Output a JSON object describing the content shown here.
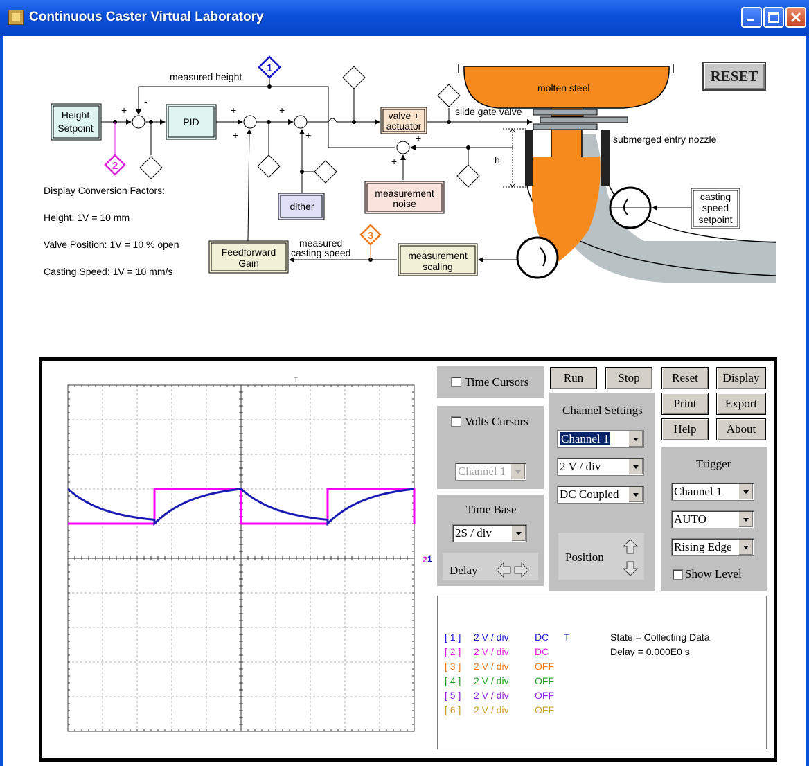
{
  "window": {
    "title": "Continuous Caster Virtual Laboratory"
  },
  "diagram": {
    "labels": {
      "measured_height": "measured height",
      "height_setpoint_1": "Height",
      "height_setpoint_2": "Setpoint",
      "pid": "PID",
      "valve_1": "valve +",
      "valve_2": "actuator",
      "slide_gate_valve": "slide gate valve",
      "molten_steel": "molten steel",
      "sen": "submerged entry nozzle",
      "h": "h",
      "dither": "dither",
      "noise_1": "measurement",
      "noise_2": "noise",
      "casting_speed_setpoint_1": "casting",
      "casting_speed_setpoint_2": "speed",
      "casting_speed_setpoint_3": "setpoint",
      "feedforward_1": "Feedforward",
      "feedforward_2": "Gain",
      "measured_casting_speed_1": "measured",
      "measured_casting_speed_2": "casting speed",
      "scaling_1": "measurement",
      "scaling_2": "scaling",
      "plus": "+",
      "minus": "-",
      "marker_1": "1",
      "marker_2": "2",
      "marker_3": "3"
    },
    "conversion": {
      "heading": "Display Conversion Factors:",
      "height": "Height:  1V = 10 mm",
      "valve": "Valve Position:  1V = 10 % open",
      "speed": "Casting Speed:  1V = 10 mm/s"
    },
    "reset_label": "RESET",
    "colors": {
      "marker_1": "#1515c8",
      "marker_2": "#e020e0",
      "marker_3": "#f07818",
      "steel": "#f78a1c",
      "nozzle": "#b8c2c4"
    }
  },
  "scope": {
    "time_cursors": "Time Cursors",
    "volts_cursors": "Volts Cursors",
    "cursor_channel": "Channel 1",
    "time_base_title": "Time Base",
    "time_base_value": "2S / div",
    "delay_label": "Delay",
    "run": "Run",
    "stop": "Stop",
    "channel_settings_title": "Channel Settings",
    "channel_select": "Channel 1",
    "volts_div": "2 V / div",
    "coupling": "DC Coupled",
    "position_label": "Position",
    "reset": "Reset",
    "display": "Display",
    "print": "Print",
    "export": "Export",
    "help": "Help",
    "about": "About",
    "trigger_title": "Trigger",
    "trigger_channel": "Channel 1",
    "trigger_mode": "AUTO",
    "trigger_edge": "Rising Edge",
    "show_level": "Show Level",
    "state": "State = Collecting Data",
    "delay_value": "Delay = 0.000E0 s",
    "channels": [
      {
        "id": "[ 1 ]",
        "scale": "2 V / div",
        "coupling": "DC",
        "trig": "T",
        "color": "#1a1ad0"
      },
      {
        "id": "[ 2 ]",
        "scale": "2 V / div",
        "coupling": "DC",
        "trig": "",
        "color": "#e020e0"
      },
      {
        "id": "[ 3 ]",
        "scale": "2 V / div",
        "coupling": "OFF",
        "trig": "",
        "color": "#f07818"
      },
      {
        "id": "[ 4 ]",
        "scale": "2 V / div",
        "coupling": "OFF",
        "trig": "",
        "color": "#20a020"
      },
      {
        "id": "[ 5 ]",
        "scale": "2 V / div",
        "coupling": "OFF",
        "trig": "",
        "color": "#9020e0"
      },
      {
        "id": "[ 6 ]",
        "scale": "2 V / div",
        "coupling": "OFF",
        "trig": "",
        "color": "#c8a020"
      }
    ],
    "traces": {
      "channel1_color": "#1a1ab4",
      "channel2_color": "#ff00ff",
      "period_div": 5,
      "high_v": 4,
      "low_v": 2,
      "marker_ground": "1",
      "marker_ground_2": "2",
      "marker_trigger": "T"
    }
  }
}
